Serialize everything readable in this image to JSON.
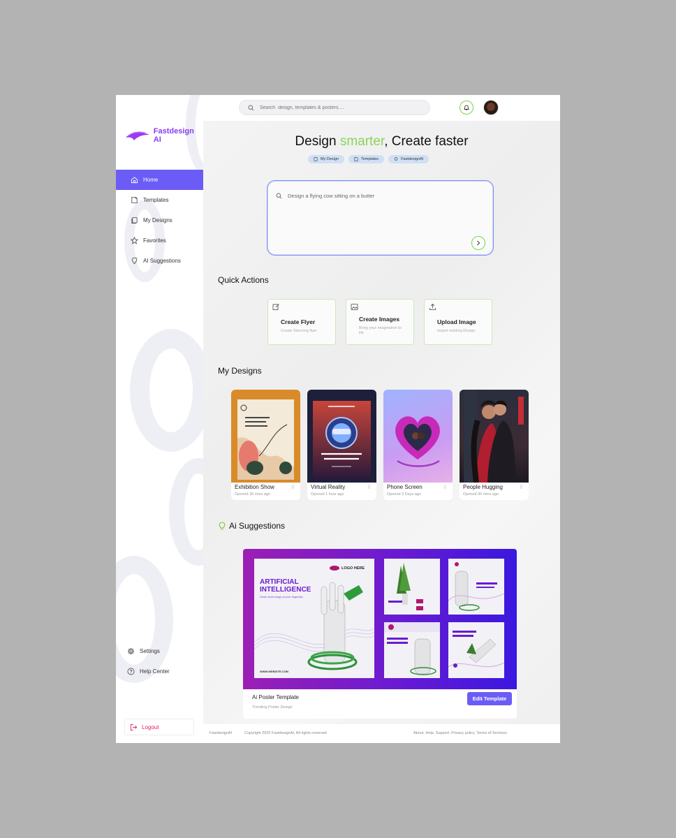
{
  "brand": {
    "name": "Fastdesign AI",
    "accent": "#6b5cf6",
    "green": "#8cd35a"
  },
  "search": {
    "placeholder": "Search  design, templates & posters...."
  },
  "sidebar": {
    "items": [
      {
        "label": "Home",
        "icon": "home-icon",
        "active": true
      },
      {
        "label": "Templates",
        "icon": "templates-icon",
        "active": false
      },
      {
        "label": "My Designs",
        "icon": "my-designs-icon",
        "active": false
      },
      {
        "label": "Favorites",
        "icon": "star-icon",
        "active": false
      },
      {
        "label": "AI Suggestions",
        "icon": "ai-bulb-icon",
        "active": false
      }
    ],
    "bottom": [
      {
        "label": "Settings",
        "icon": "gear-icon"
      },
      {
        "label": "Help Center",
        "icon": "help-icon"
      }
    ],
    "logout": "Logout"
  },
  "hero": {
    "title_pre": "Design ",
    "title_accent": "smarter",
    "title_post": ", Create faster",
    "chips": [
      "My Design",
      "Templates",
      "FastdesignAI"
    ]
  },
  "prompt": {
    "placeholder": "Design a flying cow sitting on a butter"
  },
  "quick_actions": {
    "title": "Quick Actions",
    "items": [
      {
        "title": "Create Flyer",
        "sub": "Create Stunning flyer",
        "icon": "edit-icon"
      },
      {
        "title": "Create Images",
        "sub": "Bring your imagination to life",
        "icon": "image-icon"
      },
      {
        "title": "Upload Image",
        "sub": "Import existing Design",
        "icon": "upload-icon"
      }
    ]
  },
  "my_designs": {
    "title": "My Designs",
    "items": [
      {
        "title": "Exhibition Show",
        "sub": "Opened 30 mins ago"
      },
      {
        "title": "Virtual Reality",
        "sub": "Opened 1 hour ago"
      },
      {
        "title": "Phone Screen",
        "sub": "Opened 3 Days ago"
      },
      {
        "title": "People Hugging",
        "sub": "Opened 30 mins ago"
      }
    ]
  },
  "ai_suggestions": {
    "title": "Ai Suggestions",
    "card": {
      "title": "Ai Poster Template",
      "sub": "Trending Poster Design",
      "button": "Edit Template",
      "poster_heading_1": "ARTIFICIAL",
      "poster_heading_2": "INTELLIGENCE",
      "poster_logo": "LOGO HERE",
      "poster_tag": "Smart technology at your fingertips",
      "poster_url": "WWW.WEBSITE.COM"
    }
  },
  "footer": {
    "brand": "FastdesignAI",
    "copyright": "Copyright 2025 FastdesignAI, All rights reserved",
    "links": "About. Help. Support. Privacy policy. Terms of Services"
  }
}
